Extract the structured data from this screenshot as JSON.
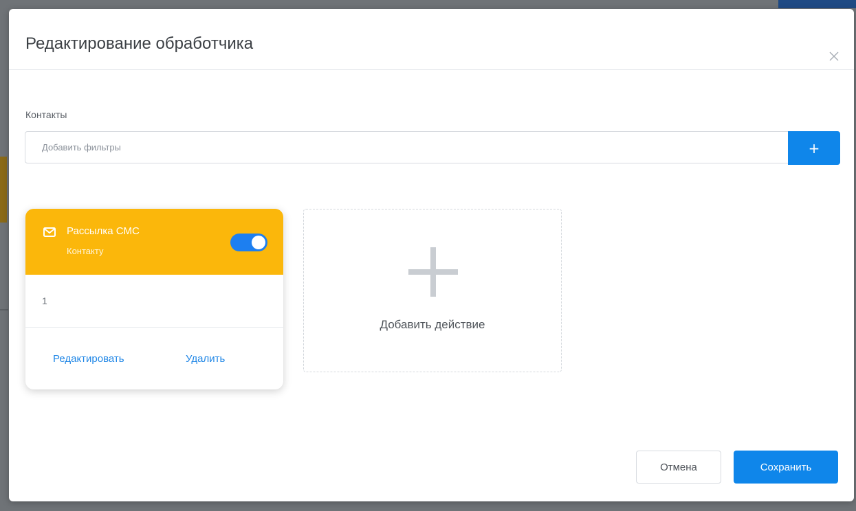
{
  "modal": {
    "title": "Редактирование обработчика",
    "close_icon": "close-icon"
  },
  "contacts": {
    "label": "Контакты",
    "filter_placeholder": "Добавить фильтры",
    "filter_value": "",
    "add_filter_label": "+"
  },
  "action_card": {
    "icon": "mail-icon",
    "title": "Рассылка СМС",
    "subtitle": "Контакту",
    "enabled": true,
    "body_text": "1",
    "edit_label": "Редактировать",
    "delete_label": "Удалить",
    "header_color": "#fbb70b"
  },
  "add_action": {
    "icon": "plus-icon",
    "label": "Добавить действие"
  },
  "footer": {
    "cancel_label": "Отмена",
    "save_label": "Сохранить"
  },
  "colors": {
    "accent": "#0f86ea",
    "link": "#1f86e6",
    "card_header": "#fbb70b"
  }
}
